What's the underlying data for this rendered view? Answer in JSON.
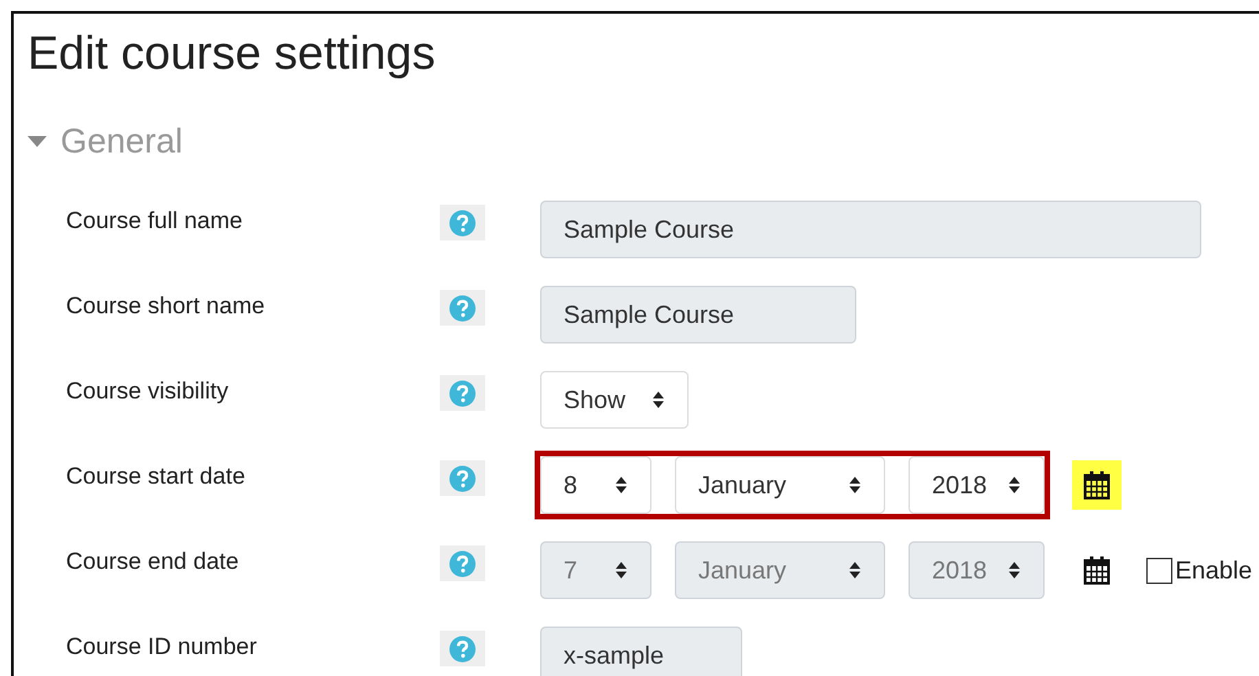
{
  "title": "Edit course settings",
  "section": {
    "label": "General",
    "expanded": true
  },
  "rows": [
    {
      "label": "Course full name",
      "kind": "text",
      "value": "Sample Course"
    },
    {
      "label": "Course short name",
      "kind": "text",
      "value": "Sample Course"
    },
    {
      "label": "Course visibility",
      "kind": "select",
      "value": "Show"
    },
    {
      "label": "Course start date",
      "kind": "date",
      "day": "8",
      "month": "January",
      "year": "2018",
      "disabled": false,
      "highlighted": true,
      "calendar_highlighted": true
    },
    {
      "label": "Course end date",
      "kind": "date",
      "day": "7",
      "month": "January",
      "year": "2018",
      "disabled": true,
      "highlighted": false,
      "calendar_highlighted": false,
      "enable": {
        "label": "Enable",
        "checked": false
      }
    },
    {
      "label": "Course ID number",
      "kind": "text",
      "value": "x-sample"
    }
  ]
}
